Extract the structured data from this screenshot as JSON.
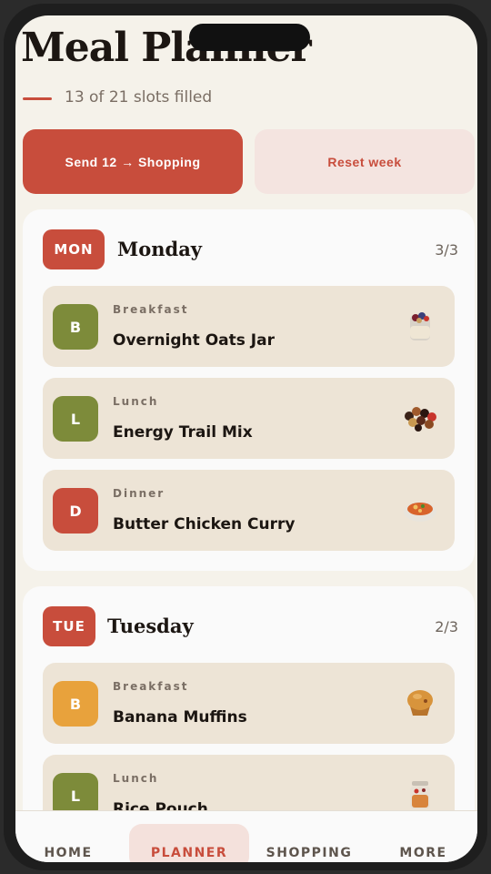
{
  "header": {
    "title": "Meal Planner",
    "slots_text": "13 of 21 slots filled"
  },
  "actions": {
    "send_label": "Send 12 → Shopping",
    "reset_label": "Reset week"
  },
  "days": [
    {
      "tag": "MON",
      "name": "Monday",
      "count": "3/3",
      "meals": [
        {
          "badge": "B",
          "type": "Breakfast",
          "name": "Overnight Oats Jar",
          "badge_color": "#7d8b3a",
          "icon": "oats-jar-icon"
        },
        {
          "badge": "L",
          "type": "Lunch",
          "name": "Energy Trail Mix",
          "badge_color": "#7d8b3a",
          "icon": "trail-mix-icon"
        },
        {
          "badge": "D",
          "type": "Dinner",
          "name": "Butter Chicken Curry",
          "badge_color": "#c84d3c",
          "icon": "curry-bowl-icon"
        }
      ]
    },
    {
      "tag": "TUE",
      "name": "Tuesday",
      "count": "2/3",
      "meals": [
        {
          "badge": "B",
          "type": "Breakfast",
          "name": "Banana Muffins",
          "badge_color": "#e8a23c",
          "icon": "muffin-icon"
        },
        {
          "badge": "L",
          "type": "Lunch",
          "name": "Rice Pouch",
          "badge_color": "#7d8b3a",
          "icon": "jar-icon"
        }
      ]
    }
  ],
  "nav": {
    "items": [
      {
        "label": "HOME"
      },
      {
        "label": "PLANNER",
        "active": true
      },
      {
        "label": "SHOPPING"
      },
      {
        "label": "MORE"
      }
    ]
  },
  "colors": {
    "accent": "#c84d3c",
    "olive": "#7d8b3a",
    "amber": "#e8a23c",
    "card_bg": "#ede4d6"
  }
}
